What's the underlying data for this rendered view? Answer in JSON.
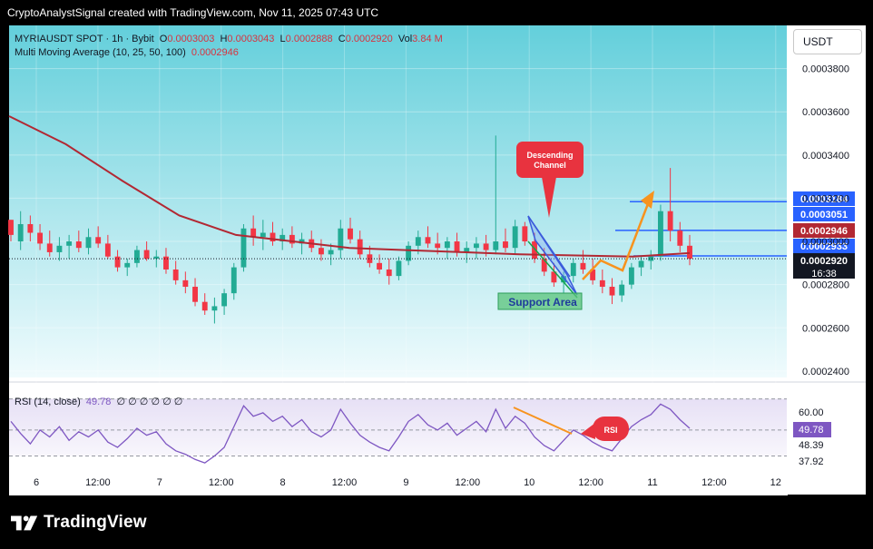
{
  "caption": "CryptoAnalystSignal created with TradingView.com, Nov 11, 2025 07:43 UTC",
  "legend": {
    "symbol": "MYRIAUSDT SPOT · 1h · Bybit",
    "open_label": "O",
    "open": "0.0003003",
    "high_label": "H",
    "high": "0.0003043",
    "low_label": "L",
    "low": "0.0002888",
    "close_label": "C",
    "close": "0.0002920",
    "vol_label": "Vol",
    "vol": "3.84 M",
    "ma_label": "Multi Moving Average (10, 25, 50, 100)",
    "ma_value": "0.0002946"
  },
  "rsi_legend": {
    "label": "RSI (14, close)",
    "value": "49.78",
    "extras": "∅ ∅ ∅ ∅ ∅ ∅"
  },
  "unit_button": "USDT",
  "brand": "TradingView",
  "annotations": {
    "descending_channel": "Descending\nChannel",
    "support_area": "Support Area",
    "rsi": "RSI"
  },
  "colors": {
    "up": "#22ab94",
    "down": "#f23645",
    "ma": "#b22833",
    "rsi": "#7e57c2",
    "hline": "#2962ff",
    "bg_top": "#63cfdb",
    "bg_bottom": "#f0fbfd",
    "orange": "#f7931e",
    "channel": "#3b5bdb",
    "callout": "#e8333f"
  },
  "chart_data": {
    "type": "candlestick",
    "x_ticks": [
      "6",
      "12:00",
      "7",
      "12:00",
      "8",
      "12:00",
      "9",
      "12:00",
      "10",
      "12:00",
      "11",
      "12:00",
      "12"
    ],
    "y_ticks": [
      "0.0003800",
      "0.0003600",
      "0.0003400",
      "0.0003200",
      "0.0003000",
      "0.0002800",
      "0.0002600",
      "0.0002400"
    ],
    "y_range": [
      0.000237,
      0.0004
    ],
    "price_labels": [
      {
        "value": "0.0003184",
        "color": "#2962ff"
      },
      {
        "value": "0.0003051",
        "color": "#2962ff"
      },
      {
        "value": "0.0002946",
        "color": "#b22833"
      },
      {
        "value": "0.0002933",
        "color": "#2962ff"
      },
      {
        "value": "0.0002920",
        "color": "#131722"
      }
    ],
    "countdown": "16:38",
    "horizontal_levels": [
      0.0003184,
      0.0003051,
      0.0002933
    ],
    "last_price": 0.000292,
    "moving_average": [
      0.000358,
      0.000345,
      0.000328,
      0.000312,
      0.000303,
      0.0003,
      0.000297,
      0.000296,
      0.000295,
      0.000294,
      0.0002935,
      0.000293,
      0.0002946
    ],
    "ohlc": [
      [
        0.00031,
        0.00031,
        0.0003,
        0.000303
      ],
      [
        0.0003,
        0.000314,
        0.000296,
        0.000308
      ],
      [
        0.000308,
        0.000312,
        0.0003,
        0.000304
      ],
      [
        0.000304,
        0.000308,
        0.000296,
        0.000299
      ],
      [
        0.000299,
        0.000305,
        0.000293,
        0.000295
      ],
      [
        0.000295,
        0.000302,
        0.000291,
        0.000298
      ],
      [
        0.000298,
        0.000303,
        0.000292,
        0.0003
      ],
      [
        0.0003,
        0.000305,
        0.000295,
        0.000297
      ],
      [
        0.000297,
        0.000306,
        0.000294,
        0.000302
      ],
      [
        0.000302,
        0.000307,
        0.000297,
        0.000299
      ],
      [
        0.000299,
        0.000303,
        0.000292,
        0.000293
      ],
      [
        0.000293,
        0.000296,
        0.000286,
        0.000288
      ],
      [
        0.000288,
        0.000292,
        0.000284,
        0.00029
      ],
      [
        0.00029,
        0.000298,
        0.000288,
        0.000296
      ],
      [
        0.000296,
        0.0003,
        0.000291,
        0.000292
      ],
      [
        0.000292,
        0.000296,
        0.000288,
        0.000293
      ],
      [
        0.000293,
        0.000297,
        0.000285,
        0.000287
      ],
      [
        0.000287,
        0.000291,
        0.00028,
        0.000282
      ],
      [
        0.000282,
        0.000286,
        0.000276,
        0.000279
      ],
      [
        0.000279,
        0.000283,
        0.00027,
        0.000272
      ],
      [
        0.000272,
        0.000276,
        0.000266,
        0.000268
      ],
      [
        0.000268,
        0.000274,
        0.000262,
        0.00027
      ],
      [
        0.00027,
        0.000278,
        0.000266,
        0.000276
      ],
      [
        0.000276,
        0.00029,
        0.000273,
        0.000288
      ],
      [
        0.000288,
        0.000308,
        0.000286,
        0.000306
      ],
      [
        0.000306,
        0.000312,
        0.000298,
        0.000302
      ],
      [
        0.000302,
        0.00031,
        0.000296,
        0.000304
      ],
      [
        0.000304,
        0.000309,
        0.000298,
        0.0003
      ],
      [
        0.0003,
        0.000306,
        0.000296,
        0.000303
      ],
      [
        0.000303,
        0.000307,
        0.000297,
        0.000299
      ],
      [
        0.000299,
        0.000304,
        0.000294,
        0.000301
      ],
      [
        0.000301,
        0.000305,
        0.000295,
        0.000297
      ],
      [
        0.000297,
        0.000301,
        0.000291,
        0.000294
      ],
      [
        0.000294,
        0.000299,
        0.000289,
        0.000296
      ],
      [
        0.000296,
        0.00031,
        0.000292,
        0.000306
      ],
      [
        0.000306,
        0.000311,
        0.000299,
        0.000301
      ],
      [
        0.000301,
        0.000305,
        0.000292,
        0.000294
      ],
      [
        0.000294,
        0.000298,
        0.000288,
        0.00029
      ],
      [
        0.00029,
        0.000294,
        0.000285,
        0.000287
      ],
      [
        0.000287,
        0.000292,
        0.00028,
        0.000284
      ],
      [
        0.000284,
        0.000293,
        0.000282,
        0.000291
      ],
      [
        0.000291,
        0.0003,
        0.000289,
        0.000298
      ],
      [
        0.000298,
        0.000305,
        0.000294,
        0.000302
      ],
      [
        0.000302,
        0.000307,
        0.000297,
        0.000299
      ],
      [
        0.000299,
        0.000304,
        0.000294,
        0.000297
      ],
      [
        0.000297,
        0.000302,
        0.000292,
        0.0003
      ],
      [
        0.0003,
        0.000304,
        0.000293,
        0.000295
      ],
      [
        0.000295,
        0.0003,
        0.00029,
        0.000297
      ],
      [
        0.000297,
        0.000302,
        0.000292,
        0.000299
      ],
      [
        0.000299,
        0.000303,
        0.000293,
        0.000296
      ],
      [
        0.000296,
        0.000349,
        0.000294,
        0.0003
      ],
      [
        0.0003,
        0.000306,
        0.000295,
        0.000297
      ],
      [
        0.000297,
        0.00031,
        0.000294,
        0.000307
      ],
      [
        0.000307,
        0.000309,
        0.000298,
        0.0003
      ],
      [
        0.0003,
        0.000304,
        0.00029,
        0.000292
      ],
      [
        0.000292,
        0.000297,
        0.000284,
        0.000286
      ],
      [
        0.000286,
        0.00029,
        0.000279,
        0.000281
      ],
      [
        0.000281,
        0.000286,
        0.000276,
        0.000284
      ],
      [
        0.000284,
        0.000292,
        0.000281,
        0.00029
      ],
      [
        0.00029,
        0.000296,
        0.000285,
        0.000287
      ],
      [
        0.000287,
        0.000292,
        0.00028,
        0.000282
      ],
      [
        0.000282,
        0.000287,
        0.000276,
        0.000279
      ],
      [
        0.000279,
        0.000283,
        0.000271,
        0.000275
      ],
      [
        0.000275,
        0.000282,
        0.000272,
        0.00028
      ],
      [
        0.00028,
        0.00029,
        0.000278,
        0.000288
      ],
      [
        0.000288,
        0.000293,
        0.000284,
        0.000291
      ],
      [
        0.000291,
        0.000296,
        0.000287,
        0.000293
      ],
      [
        0.000293,
        0.000317,
        0.000291,
        0.000314
      ],
      [
        0.000314,
        0.000334,
        0.0003,
        0.000305
      ],
      [
        0.000305,
        0.000309,
        0.000295,
        0.000298
      ],
      [
        0.000298,
        0.000303,
        0.000289,
        0.000292
      ]
    ],
    "rsi": {
      "label": "RSI (14, close)",
      "y_ticks": [
        "60.00",
        "48.39",
        "37.92"
      ],
      "current": "49.78",
      "values": [
        55,
        48,
        42,
        50,
        46,
        52,
        44,
        49,
        46,
        50,
        43,
        40,
        45,
        51,
        47,
        49,
        42,
        38,
        36,
        33,
        31,
        35,
        40,
        52,
        64,
        58,
        60,
        55,
        58,
        52,
        56,
        49,
        46,
        50,
        62,
        54,
        47,
        43,
        40,
        38,
        46,
        55,
        59,
        53,
        50,
        54,
        47,
        51,
        55,
        49,
        62,
        51,
        58,
        54,
        46,
        41,
        38,
        44,
        50,
        47,
        43,
        40,
        38,
        45,
        52,
        56,
        59,
        65,
        62,
        56,
        51
      ]
    }
  }
}
